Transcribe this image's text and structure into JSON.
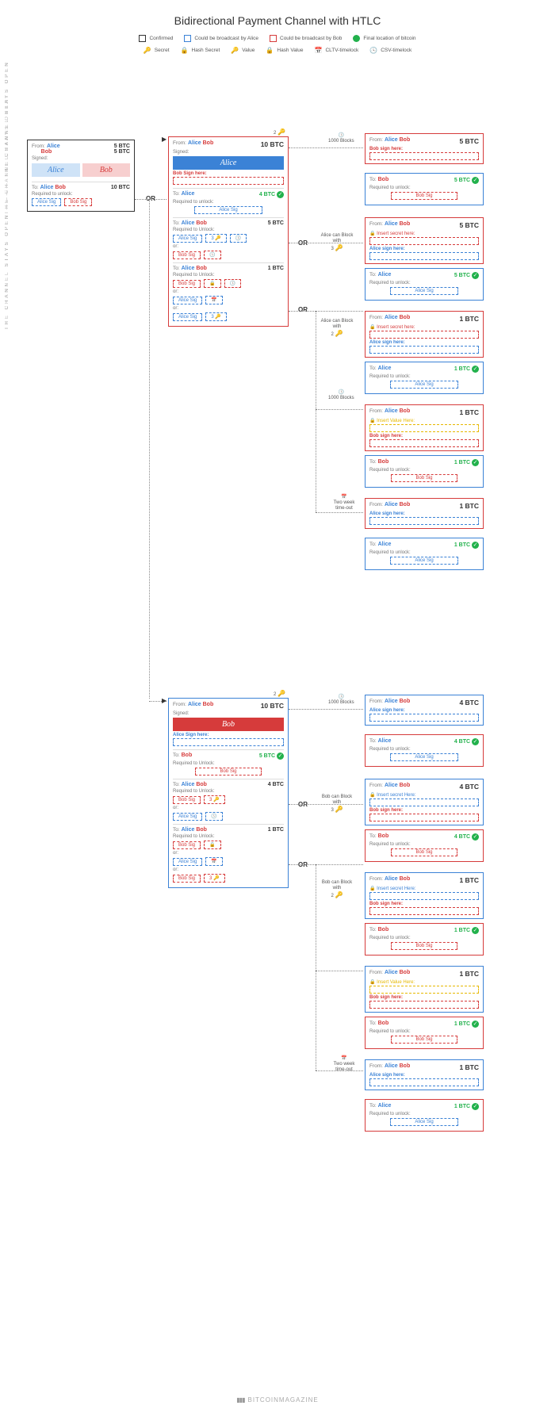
{
  "title": "Bidirectional Payment Channel with HTLC",
  "legend_row1": {
    "confirmed": "Confirmed",
    "alice_broadcast": "Could be broadcast by Alice",
    "bob_broadcast": "Could be broadcast by Bob",
    "final_loc": "Final location of bitcoin"
  },
  "legend_row2": {
    "secret": "Secret",
    "hash_secret": "Hash Secret",
    "value": "Value",
    "hash_value": "Hash Value",
    "cltv": "CLTV-timelock",
    "csv": "CSV-timelock"
  },
  "labels": {
    "from": "From:",
    "to": "To:",
    "signed": "Signed:",
    "req_unlock": "Required to unlock:",
    "req_unlock2": "Required to Unlock:",
    "or": "or:",
    "bob_sign_here": "Bob Sign here:",
    "alice_sign_here": "Alice sign here:",
    "bob_sign_here2": "Bob sign here:",
    "alice_sign_here2": "Alice Sign here:",
    "insert_secret": "Insert secret here:",
    "insert_secret2": "Insert secret Here:",
    "insert_value": "Insert Value Here:",
    "alice_sig": "Alice Sig",
    "bob_sig": "Bob Sig"
  },
  "names": {
    "alice": "Alice",
    "bob": "Bob"
  },
  "annotations": {
    "or": "OR",
    "blocks_1000": "1000 Blocks",
    "alice_can_block": "Alice can Block with",
    "bob_can_block": "Bob can Block with",
    "two_week": "Two week time-out"
  },
  "side_text": "THE CHANNEL STAYS OPEN ———— THE CHANNEL STAYS OPEN",
  "side_text_short": "THE CHANNEL STAYS OPEN",
  "funding": {
    "from_alice_btc": "5 BTC",
    "from_bob_btc": "5 BTC",
    "to_btc": "10 BTC"
  },
  "commit_top": {
    "from_btc": "10 BTC",
    "out1": {
      "to": "Alice",
      "btc": "4 BTC"
    },
    "out2": {
      "to": "Alice  Bob",
      "btc": "5 BTC"
    },
    "out3": {
      "to": "Alice  Bob",
      "btc": "1 BTC"
    }
  },
  "right_top": {
    "r1": {
      "btc": "5 BTC",
      "to_btc": "5 BTC",
      "to": "Bob"
    },
    "r2": {
      "btc": "5 BTC",
      "to_btc": "5 BTC",
      "to": "Alice"
    },
    "r3": {
      "btc": "1 BTC",
      "to_btc": "1 BTC",
      "to": "Alice"
    },
    "r4": {
      "btc": "1 BTC",
      "to_btc": "1 BTC",
      "to": "Bob"
    },
    "r5": {
      "btc": "1 BTC",
      "to_btc": "1 BTC",
      "to": "Alice"
    }
  },
  "commit_bottom": {
    "from_btc": "10 BTC",
    "out1": {
      "to": "Bob",
      "btc": "5 BTC"
    },
    "out2": {
      "to": "Alice  Bob",
      "btc": "4 BTC"
    },
    "out3": {
      "to": "Alice  Bob",
      "btc": "1 BTC"
    }
  },
  "right_bottom": {
    "r1": {
      "btc": "4 BTC",
      "to_btc": "4 BTC",
      "to": "Alice"
    },
    "r2": {
      "btc": "4 BTC",
      "to_btc": "4 BTC",
      "to": "Bob"
    },
    "r3": {
      "btc": "1 BTC",
      "to_btc": "1 BTC",
      "to": "Bob"
    },
    "r4": {
      "btc": "1 BTC",
      "to_btc": "1 BTC",
      "to": "Bob"
    },
    "r5": {
      "btc": "1 BTC",
      "to_btc": "1 BTC",
      "to": "Alice"
    }
  },
  "badge_numbers": {
    "key2": "2",
    "key3": "3",
    "lock3": "3"
  },
  "footer": "BITCOINMAGAZINE"
}
